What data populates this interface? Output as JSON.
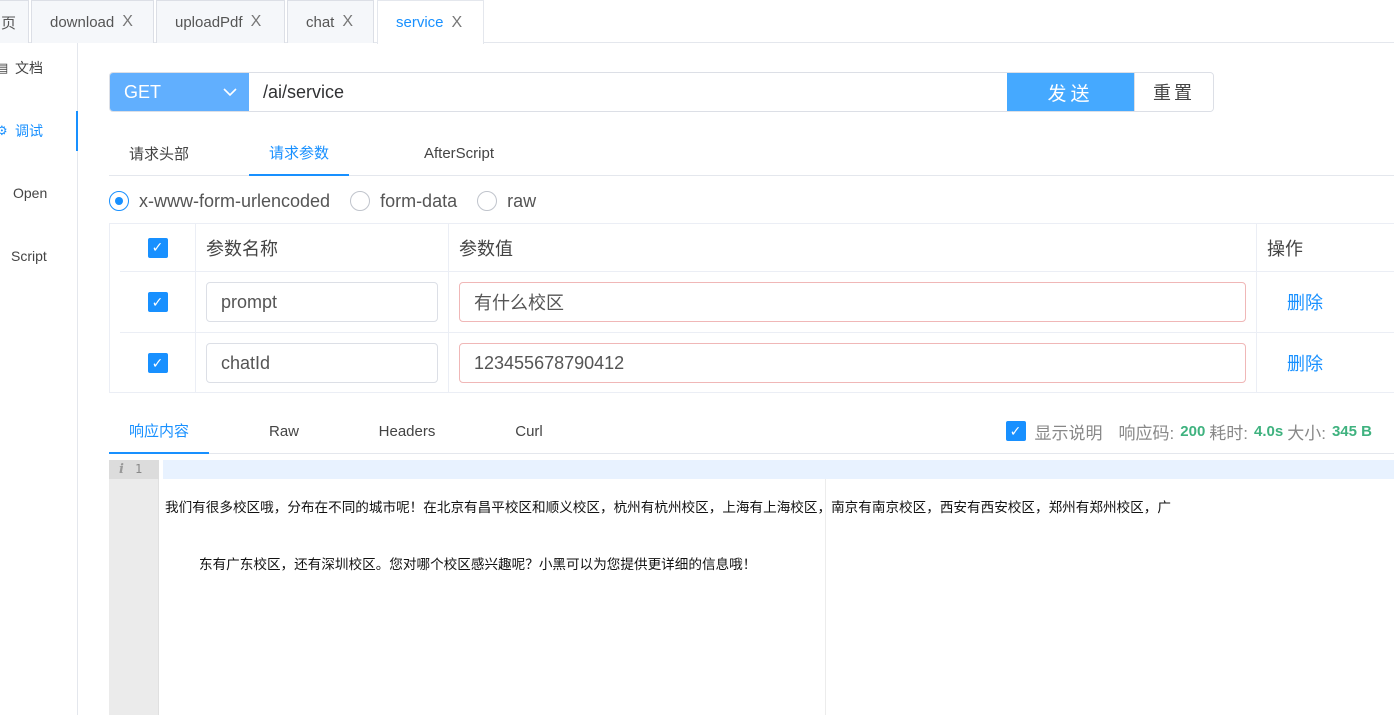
{
  "tabs": [
    {
      "label": "页",
      "active": false
    },
    {
      "label": "download",
      "active": false
    },
    {
      "label": "uploadPdf",
      "active": false
    },
    {
      "label": "chat",
      "active": false
    },
    {
      "label": "service",
      "active": true
    }
  ],
  "tab_close": "X",
  "sidebar": {
    "items": [
      {
        "label": "文档",
        "icon": "document-icon"
      },
      {
        "label": "调试",
        "icon": "debug-icon",
        "active": true
      },
      {
        "label": "Open",
        "icon": "open-icon"
      },
      {
        "label": "Script",
        "icon": "script-icon"
      }
    ]
  },
  "request": {
    "method": "GET",
    "url": "/ai/service",
    "send_label": "发送",
    "reset_label": "重置"
  },
  "request_tabs": [
    "请求头部",
    "请求参数",
    "AfterScript"
  ],
  "active_request_tab": "请求参数",
  "body_types": [
    "x-www-form-urlencoded",
    "form-data",
    "raw"
  ],
  "selected_body_type": "x-www-form-urlencoded",
  "params_table": {
    "headers": [
      "参数名称",
      "参数值",
      "操作"
    ],
    "rows": [
      {
        "checked": true,
        "name": "prompt",
        "value": "有什么校区",
        "action": "删除"
      },
      {
        "checked": true,
        "name": "chatId",
        "value": "123455678790412",
        "action": "删除"
      }
    ]
  },
  "response_tabs": [
    "响应内容",
    "Raw",
    "Headers",
    "Curl"
  ],
  "active_response_tab": "响应内容",
  "response_info": {
    "show_desc_label": "显示说明",
    "show_desc_checked": true,
    "code_label": "响应码:",
    "code": "200",
    "time_label": "耗时:",
    "time": "4.0s",
    "size_label": "大小:",
    "size": "345 B"
  },
  "editor": {
    "line_number": "1",
    "info_glyph": "i",
    "line1": "我们有很多校区哦，分布在不同的城市呢！在北京有昌平校区和顺义校区，杭州有杭州校区，上海有上海校区，南京有南京校区，西安有西安校区，郑州有郑州校区，广",
    "line2": "东有广东校区，还有深圳校区。您对哪个校区感兴趣呢？小黑可以为您提供更详细的信息哦！"
  },
  "colors": {
    "accent": "#1890ff",
    "method_bg": "#61affe",
    "send_bg": "#45a9ff",
    "success": "#3fb27f"
  }
}
